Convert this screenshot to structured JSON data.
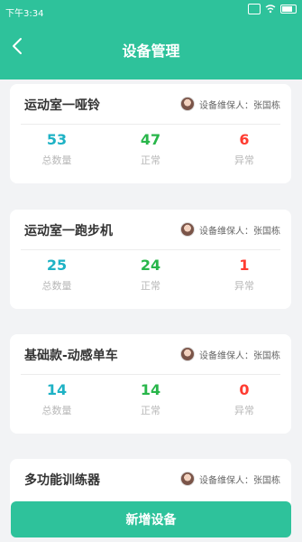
{
  "status": {
    "time": "下午3:34"
  },
  "header": {
    "title": "设备管理",
    "back_icon": "chevron-left-icon"
  },
  "colors": {
    "brand": "#2ec29b",
    "total": "#1eb2c5",
    "normal": "#28b64a",
    "abnormal": "#ff3b30"
  },
  "cards": [
    {
      "name": "运动室一哑铃",
      "maintainer": "设备维保人：张国栋",
      "total": "53",
      "normal": "47",
      "abnormal": "6"
    },
    {
      "name": "运动室一跑步机",
      "maintainer": "设备维保人：张国栋",
      "total": "25",
      "normal": "24",
      "abnormal": "1"
    },
    {
      "name": "基础款-动感单车",
      "maintainer": "设备维保人：张国栋",
      "total": "14",
      "normal": "14",
      "abnormal": "0"
    },
    {
      "name": "多功能训练器",
      "maintainer": "设备维保人：张国栋"
    }
  ],
  "labels": {
    "total": "总数量",
    "normal": "正常",
    "abnormal": "异常"
  },
  "bottom_button": "新增设备"
}
